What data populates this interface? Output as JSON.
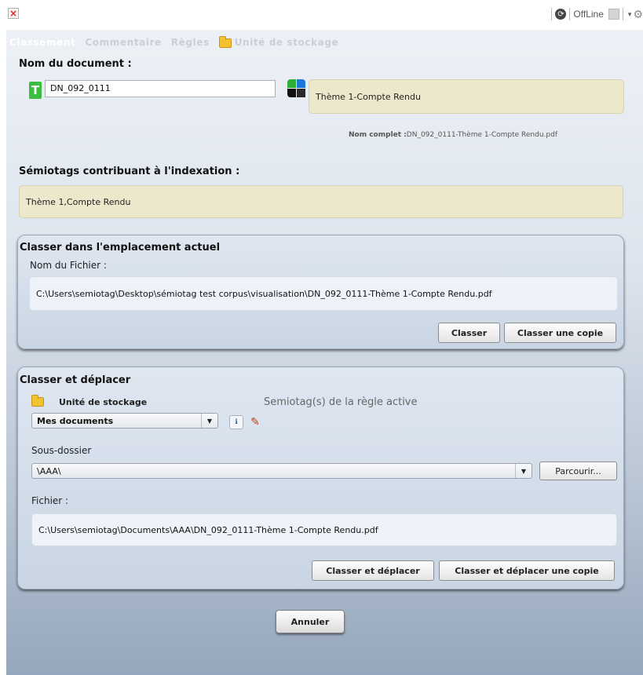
{
  "toolbar": {
    "offline_label": "OffLine"
  },
  "tabs": [
    {
      "label": "Classement",
      "active": true
    },
    {
      "label": "Commentaire",
      "active": false
    },
    {
      "label": "Règles",
      "active": false
    },
    {
      "label": "Unité de stockage",
      "active": false
    }
  ],
  "document": {
    "title": "Nom du document :",
    "name_value": "DN_092_0111",
    "theme_value": "Thème 1-Compte Rendu",
    "full_name_label": "Nom complet :",
    "full_name_value": "DN_092_0111-Thème 1-Compte Rendu.pdf"
  },
  "semiotags": {
    "title": "Sémiotags contribuant à l'indexation :",
    "value": "Thème 1,Compte Rendu"
  },
  "current_location": {
    "title": "Classer dans l'emplacement actuel",
    "file_label": "Nom du Fichier :",
    "file_path": "C:\\Users\\semiotag\\Desktop\\sémiotag test corpus\\visualisation\\DN_092_0111-Thème 1-Compte Rendu.pdf",
    "classer_label": "Classer",
    "classer_copie_label": "Classer une copie"
  },
  "move": {
    "title": "Classer et déplacer",
    "storage_label": "Unité de stockage",
    "rule_semiotags_label": "Semiotag(s) de la règle active",
    "storage_selected": "Mes documents",
    "subfolder_label": "Sous-dossier",
    "subfolder_value": "\\AAA\\",
    "browse_label": "Parcourir...",
    "file_label": "Fichier :",
    "file_path": "C:\\Users\\semiotag\\Documents\\AAA\\DN_092_0111-Thème 1-Compte Rendu.pdf",
    "move_label": "Classer et déplacer",
    "move_copy_label": "Classer et déplacer une copie"
  },
  "cancel_label": "Annuler",
  "colors": {
    "tab_active": "#ffffff",
    "tab_inactive": "#c9cfd8",
    "beige_field": "#ede8cc",
    "green_icon": "#3bbd3f",
    "folder": "#f2c230"
  }
}
